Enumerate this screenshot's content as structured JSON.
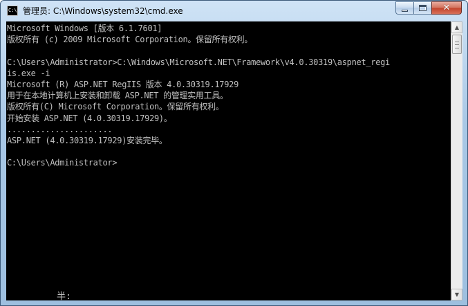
{
  "window": {
    "title": "管理员: C:\\Windows\\system32\\cmd.exe",
    "icon": "cmd-icon",
    "icon_label": "C:\\",
    "buttons": {
      "minimize": "minimize-icon",
      "maximize": "maximize-icon",
      "close": "close-icon",
      "close_glyph": "✕"
    }
  },
  "console": {
    "background": "#000000",
    "foreground": "#c0c0c0",
    "lines": [
      "Microsoft Windows [版本 6.1.7601]",
      "版权所有 (c) 2009 Microsoft Corporation。保留所有权利。",
      "",
      "C:\\Users\\Administrator>C:\\Windows\\Microsoft.NET\\Framework\\v4.0.30319\\aspnet_regi",
      "is.exe -i",
      "Microsoft (R) ASP.NET RegIIS 版本 4.0.30319.17929",
      "用于在本地计算机上安装和卸载 ASP.NET 的管理实用工具。",
      "版权所有(C) Microsoft Corporation。保留所有权利。",
      "开始安装 ASP.NET (4.0.30319.17929)。",
      "......................",
      "ASP.NET (4.0.30319.17929)安装完毕。",
      "",
      "C:\\Users\\Administrator>"
    ],
    "ime_status": "半:"
  },
  "scrollbar": {
    "up_arrow": "▲",
    "down_arrow": "▼"
  }
}
